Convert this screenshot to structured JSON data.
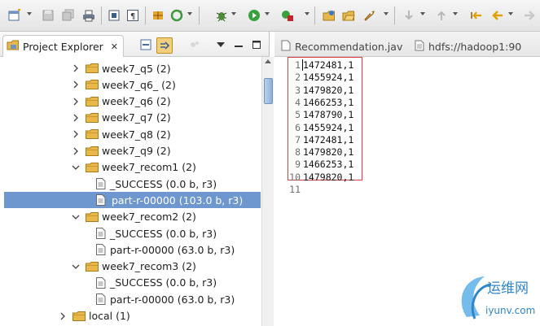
{
  "explorer": {
    "title": "Project Explorer",
    "close_glyph": "✕",
    "items": [
      {
        "label": "week7_q5 (2)",
        "kind": "folder",
        "expanded": false,
        "indent": 1
      },
      {
        "label": "week7_q6_ (2)",
        "kind": "folder",
        "expanded": false,
        "indent": 1
      },
      {
        "label": "week7_q6 (2)",
        "kind": "folder",
        "expanded": false,
        "indent": 1
      },
      {
        "label": "week7_q7 (2)",
        "kind": "folder",
        "expanded": false,
        "indent": 1
      },
      {
        "label": "week7_q8 (2)",
        "kind": "folder",
        "expanded": false,
        "indent": 1
      },
      {
        "label": "week7_q9 (2)",
        "kind": "folder",
        "expanded": false,
        "indent": 1
      },
      {
        "label": "week7_recom1 (2)",
        "kind": "folder",
        "expanded": true,
        "indent": 1
      },
      {
        "label": "_SUCCESS (0.0 b, r3)",
        "kind": "file",
        "indent": 2
      },
      {
        "label": "part-r-00000 (103.0 b, r3)",
        "kind": "file",
        "indent": 2,
        "selected": true
      },
      {
        "label": "week7_recom2 (2)",
        "kind": "folder",
        "expanded": true,
        "indent": 1
      },
      {
        "label": "_SUCCESS (0.0 b, r3)",
        "kind": "file",
        "indent": 2
      },
      {
        "label": "part-r-00000 (63.0 b, r3)",
        "kind": "file",
        "indent": 2
      },
      {
        "label": "week7_recom3 (2)",
        "kind": "folder",
        "expanded": true,
        "indent": 1
      },
      {
        "label": "_SUCCESS (0.0 b, r3)",
        "kind": "file",
        "indent": 2
      },
      {
        "label": "part-r-00000 (63.0 b, r3)",
        "kind": "file",
        "indent": 2
      },
      {
        "label": "local (1)",
        "kind": "folder",
        "expanded": false,
        "indent": 0
      }
    ]
  },
  "editor": {
    "tabs": [
      {
        "label": "Recommendation.jav"
      },
      {
        "label": "hdfs://hadoop1:90"
      }
    ],
    "lines": [
      {
        "num": "1",
        "text": "1472481,1"
      },
      {
        "num": "2",
        "text": "1455924,1"
      },
      {
        "num": "3",
        "text": "1479820,1"
      },
      {
        "num": "4",
        "text": "1466253,1"
      },
      {
        "num": "5",
        "text": "1478790,1"
      },
      {
        "num": "6",
        "text": "1455924,1"
      },
      {
        "num": "7",
        "text": "1472481,1"
      },
      {
        "num": "8",
        "text": "1479820,1"
      },
      {
        "num": "9",
        "text": "1466253,1"
      },
      {
        "num": "10",
        "text": "1479820,1"
      },
      {
        "num": "11",
        "text": ""
      }
    ]
  },
  "watermark": {
    "line1": "运维网",
    "line2": "iyunv.com"
  },
  "colors": {
    "selection": "#6f97cf",
    "highlight_box": "#e03a3a",
    "folder": "#e8b84a",
    "watermark": "#2f86c9"
  }
}
